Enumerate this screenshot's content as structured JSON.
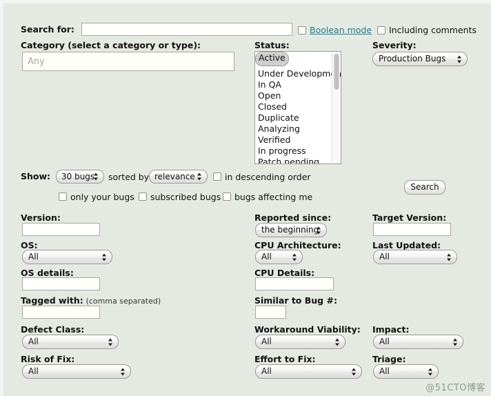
{
  "search_row": {
    "label": "Search for:",
    "input_value": "",
    "boolean_mode_label": "Boolean mode",
    "including_comments_label": "Including comments"
  },
  "category": {
    "label": "Category (select a category or type):",
    "placeholder": "Any",
    "value": ""
  },
  "status": {
    "label": "Status:",
    "selected": "Active",
    "options": [
      "Active",
      "Under Development",
      "In QA",
      "Open",
      "Closed",
      "Duplicate",
      "Analyzing",
      "Verified",
      "In progress",
      "Patch pending"
    ]
  },
  "severity": {
    "label": "Severity:",
    "value": "Production Bugs"
  },
  "show_row": {
    "label": "Show:",
    "count_value": "30 bugs",
    "sorted_by_label": "sorted by",
    "sort_value": "relevance",
    "descending_label": "in descending order"
  },
  "filter_row": {
    "only_your_bugs": "only your bugs",
    "subscribed_bugs": "subscribed bugs",
    "bugs_affecting_me": "bugs affecting me"
  },
  "search_button": {
    "label": "Search"
  },
  "fields": {
    "version": {
      "label": "Version:",
      "value": ""
    },
    "os": {
      "label": "OS:",
      "value": "All"
    },
    "os_details": {
      "label": "OS details:",
      "value": ""
    },
    "tagged_with": {
      "label": "Tagged with:",
      "note": "(comma separated)",
      "value": ""
    },
    "defect_class": {
      "label": "Defect Class:",
      "value": "All"
    },
    "risk_of_fix": {
      "label": "Risk of Fix:",
      "value": "All"
    },
    "reported_since": {
      "label": "Reported since:",
      "value": "the beginning"
    },
    "cpu_architecture": {
      "label": "CPU Architecture:",
      "value": "All"
    },
    "cpu_details": {
      "label": "CPU Details:",
      "value": ""
    },
    "similar_to_bug": {
      "label": "Similar to Bug #:",
      "value": ""
    },
    "workaround_viability": {
      "label": "Workaround Viability:",
      "value": "All"
    },
    "effort_to_fix": {
      "label": "Effort to Fix:",
      "value": "All"
    },
    "target_version": {
      "label": "Target Version:",
      "value": ""
    },
    "last_updated": {
      "label": "Last Updated:",
      "value": "All"
    },
    "impact": {
      "label": "Impact:",
      "value": "All"
    },
    "triage": {
      "label": "Triage:",
      "value": "All"
    }
  },
  "watermark": {
    "text": "@51CTO博客"
  },
  "colors": {
    "background": "#e4e9e2",
    "link": "#2a7c8c",
    "selected_row": "#cecece"
  }
}
